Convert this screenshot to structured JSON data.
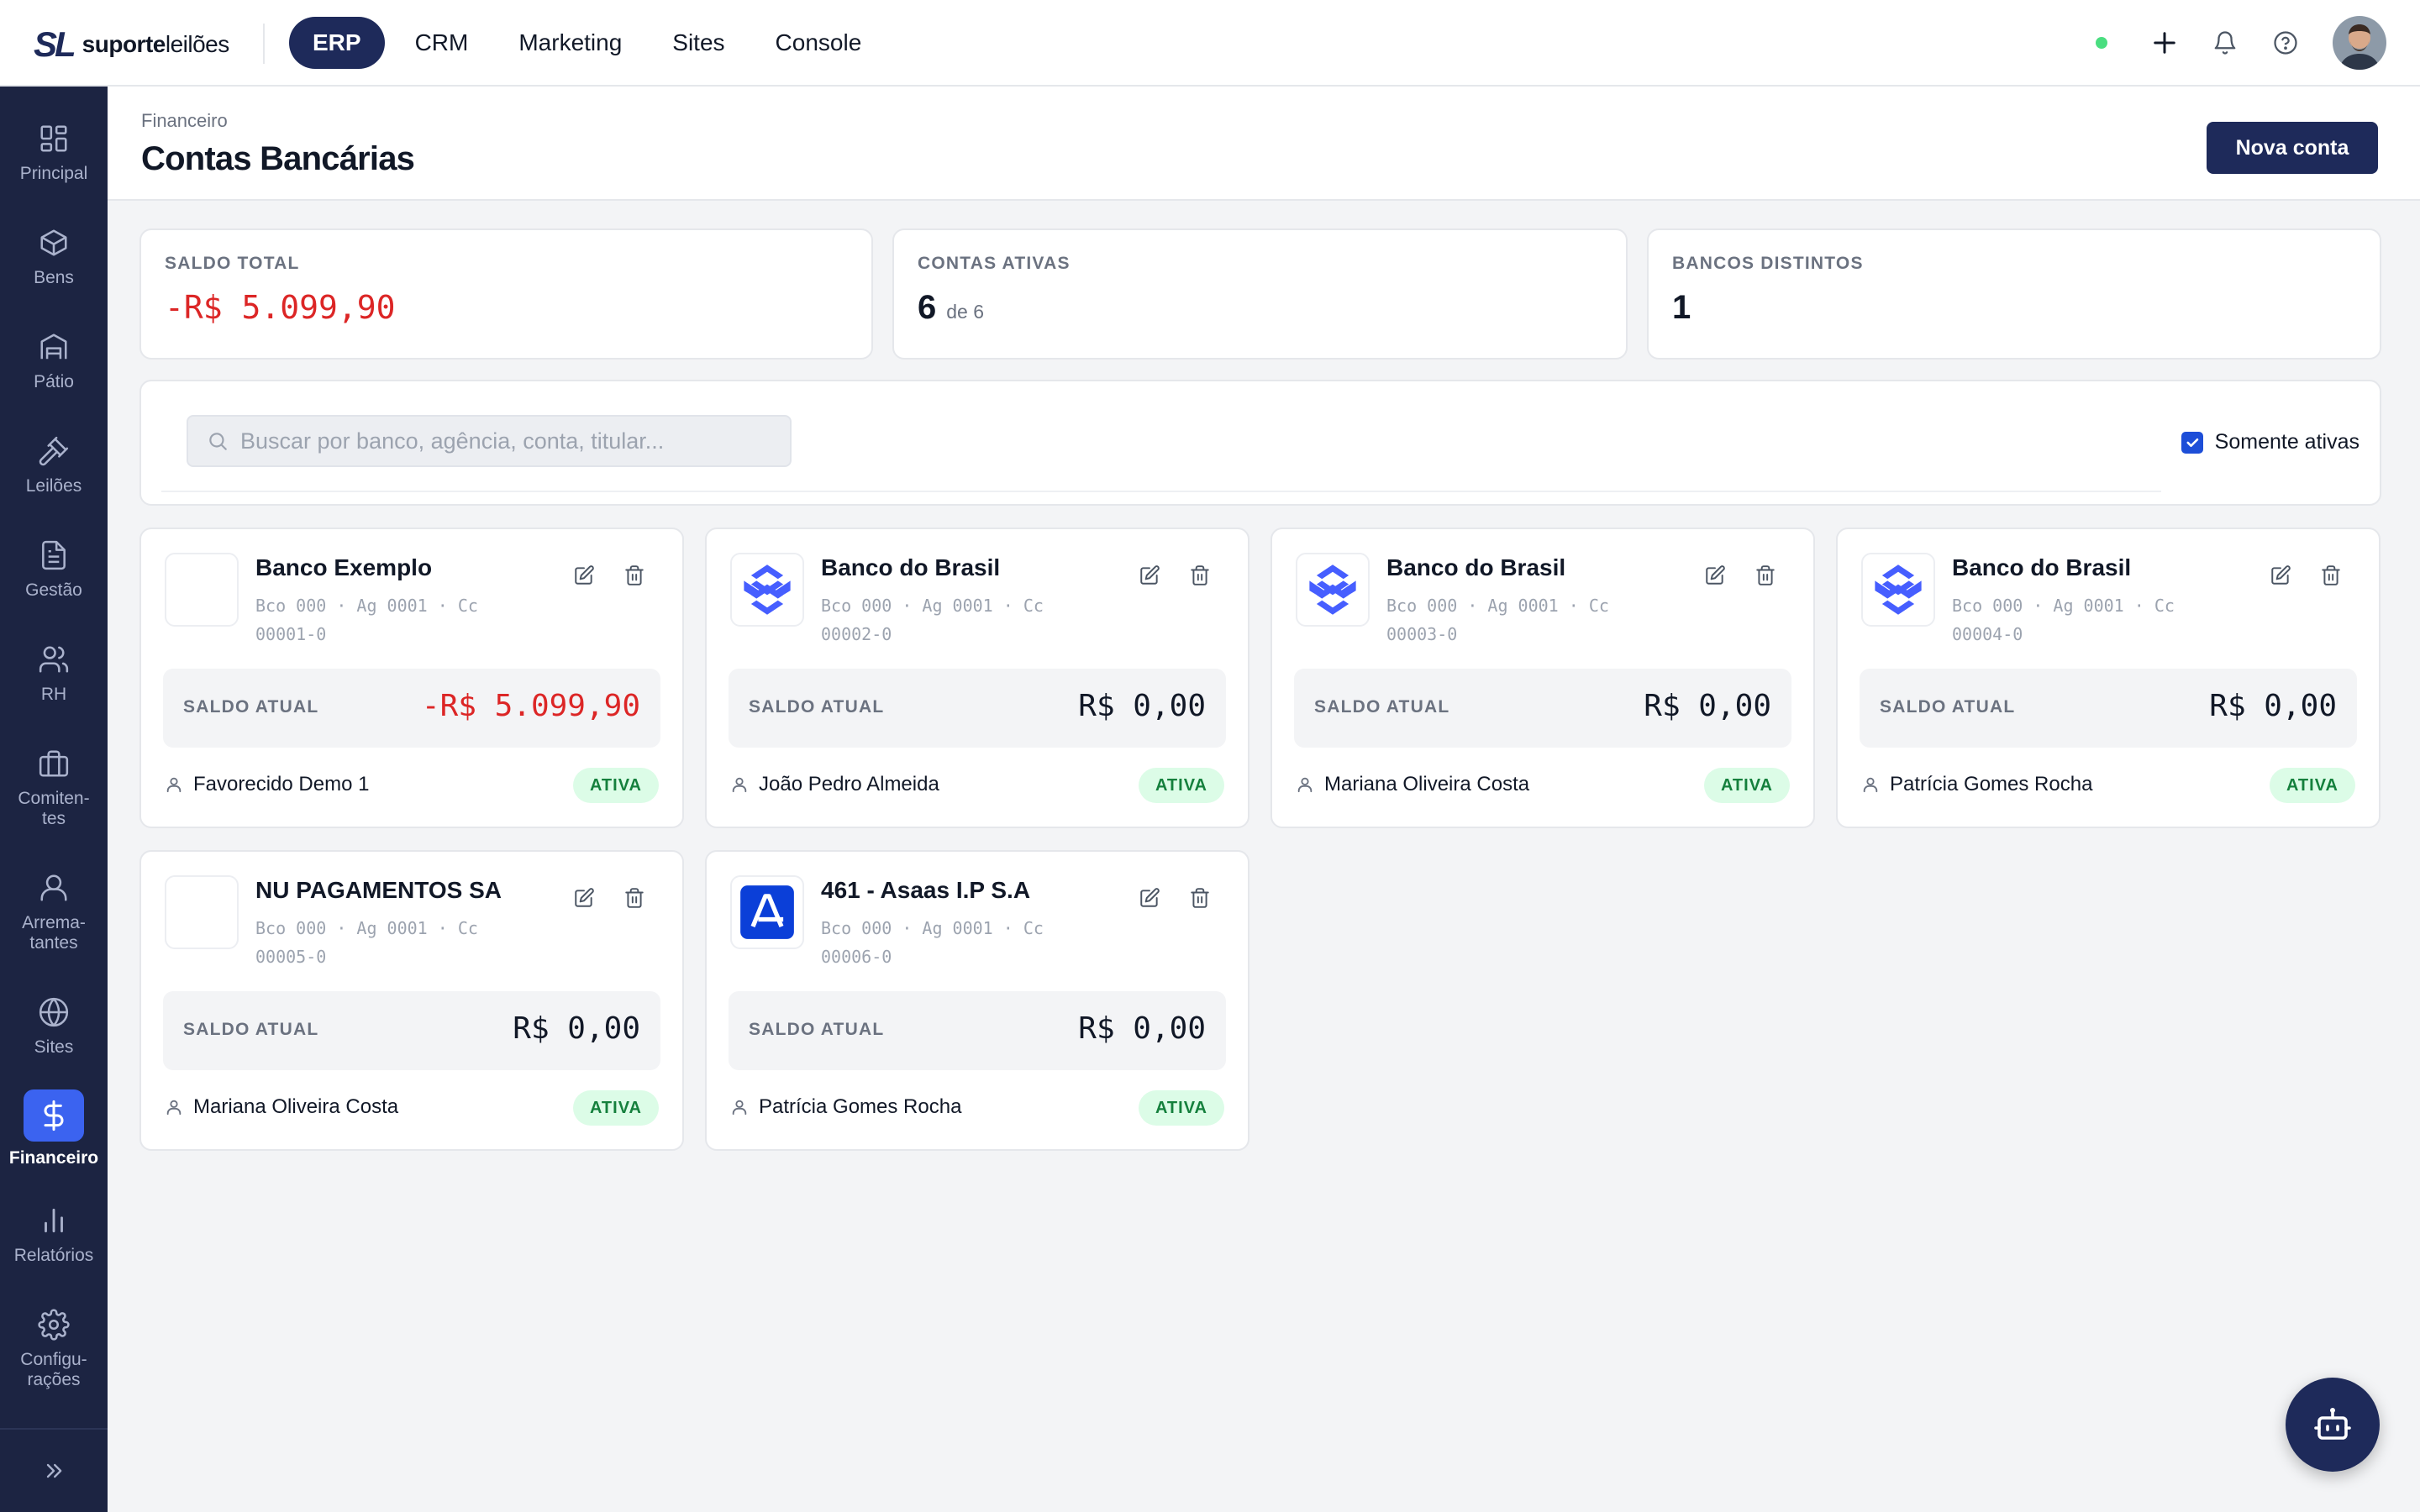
{
  "brand": {
    "mark": "SL",
    "name_bold": "suporte",
    "name_light": "leilões"
  },
  "topnav": {
    "items": [
      {
        "label": "ERP",
        "active": true
      },
      {
        "label": "CRM"
      },
      {
        "label": "Marketing"
      },
      {
        "label": "Sites"
      },
      {
        "label": "Console"
      }
    ],
    "icons": [
      "status-dot",
      "plus-icon",
      "bell-icon",
      "help-icon",
      "avatar"
    ]
  },
  "sidebar": {
    "items": [
      {
        "label": "Principal",
        "icon": "grid-icon"
      },
      {
        "label": "Bens",
        "icon": "box-icon"
      },
      {
        "label": "Pátio",
        "icon": "warehouse-icon"
      },
      {
        "label": "Leilões",
        "icon": "gavel-icon"
      },
      {
        "label": "Gestão",
        "icon": "document-icon"
      },
      {
        "label": "RH",
        "icon": "users-icon"
      },
      {
        "label": "Comiten-\ntes",
        "icon": "briefcase-icon"
      },
      {
        "label": "Arrema-\ntantes",
        "icon": "user-icon"
      },
      {
        "label": "Sites",
        "icon": "globe-icon"
      },
      {
        "label": "Financeiro",
        "icon": "dollar-icon",
        "active": true
      },
      {
        "label": "Relatórios",
        "icon": "bar-chart-icon"
      },
      {
        "label": "Configu-\nrações",
        "icon": "gear-icon"
      }
    ]
  },
  "header": {
    "breadcrumb": "Financeiro",
    "title": "Contas Bancárias",
    "new_button": "Nova conta"
  },
  "stats": {
    "total_balance": {
      "label": "SALDO TOTAL",
      "value": "-R$ 5.099,90"
    },
    "active_accounts": {
      "label": "CONTAS ATIVAS",
      "value": "6",
      "sub": "de 6"
    },
    "distinct_banks": {
      "label": "BANCOS DISTINTOS",
      "value": "1"
    }
  },
  "filters": {
    "search_placeholder": "Buscar por banco, agência, conta, titular...",
    "only_active_label": "Somente ativas",
    "only_active_checked": true
  },
  "accounts": [
    {
      "bank": "Banco Exemplo",
      "details": "Bco 000 · Ag 0001 · Cc 00001-0",
      "balance_label": "SALDO ATUAL",
      "balance": "-R$ 5.099,90",
      "holder": "Favorecido Demo 1",
      "status": "ATIVA",
      "logo": "blank"
    },
    {
      "bank": "Banco do Brasil",
      "details": "Bco 000 · Ag 0001 · Cc 00002-0",
      "balance_label": "SALDO ATUAL",
      "balance": "R$ 0,00",
      "holder": "João Pedro Almeida",
      "status": "ATIVA",
      "logo": "bb-logo"
    },
    {
      "bank": "Banco do Brasil",
      "details": "Bco 000 · Ag 0001 · Cc 00003-0",
      "balance_label": "SALDO ATUAL",
      "balance": "R$ 0,00",
      "holder": "Mariana Oliveira Costa",
      "status": "ATIVA",
      "logo": "bb-logo"
    },
    {
      "bank": "Banco do Brasil",
      "details": "Bco 000 · Ag 0001 · Cc 00004-0",
      "balance_label": "SALDO ATUAL",
      "balance": "R$ 0,00",
      "holder": "Patrícia Gomes Rocha",
      "status": "ATIVA",
      "logo": "bb-logo"
    },
    {
      "bank": "NU PAGAMENTOS SA",
      "details": "Bco 000 · Ag 0001 · Cc 00005-0",
      "balance_label": "SALDO ATUAL",
      "balance": "R$ 0,00",
      "holder": "Mariana Oliveira Costa",
      "status": "ATIVA",
      "logo": "blank"
    },
    {
      "bank": "461 - Asaas I.P S.A",
      "details": "Bco 000 · Ag 0001 · Cc 00006-0",
      "balance_label": "SALDO ATUAL",
      "balance": "R$ 0,00",
      "holder": "Patrícia Gomes Rocha",
      "status": "ATIVA",
      "logo": "asaas-logo"
    }
  ],
  "colors": {
    "navy": "#1e2a5a",
    "sidebar_bg": "#1c2442",
    "active_blue": "#3b63f0",
    "negative": "#dc2626",
    "badge_bg": "#dcfce7",
    "badge_text": "#15803d",
    "bb_blue": "#465eff"
  },
  "fab": {
    "icon": "bot-icon"
  }
}
